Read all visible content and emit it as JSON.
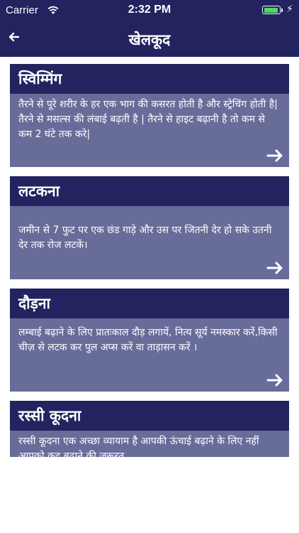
{
  "status_bar": {
    "carrier": "Carrier",
    "time": "2:32 PM",
    "wifi_icon": "wifi-icon",
    "battery_icon": "battery-icon",
    "charging_icon": "bolt-icon",
    "battery_color": "#4cd964"
  },
  "nav": {
    "title": "खेलकूद",
    "back_icon": "back-arrow-icon"
  },
  "theme": {
    "header_color": "#22235f",
    "card_body_color": "#686c99",
    "text_color": "#ffffff"
  },
  "cards": [
    {
      "title": "स्विम्मिंग",
      "body": "तैरने से पूरे शरीर के हर एक भाग की कसरत होती है और स्ट्रेचिंग होती है| तैरने से मसल्स की लंबाई बढ़ती है | तैरने से हाइट बढ़ानी है तो कम से कम 2 घंटे तक करे|",
      "arrow_icon": "right-arrow-icon"
    },
    {
      "title": "लटकना",
      "body": "जमीन से 7 फुट पर एक छंड गाड़े और उस पर जितनी देर हो सके उतनी देर तक रोज लटकें।",
      "arrow_icon": "right-arrow-icon"
    },
    {
      "title": "दौड़ना",
      "body": "लम्बाई बढ़ाने के लिए प्रातःकाल दौड़ लगायें, नित्य सूर्य नमस्कार करें,किसी चीज़ से लटक कर पुल अप्स करें वा ताड़ासन करें ।",
      "arrow_icon": "right-arrow-icon"
    },
    {
      "title": "रस्सी कूदना",
      "body": "रस्सी कूदना एक अच्छा व्यायाम है आपकी ऊंचाई बढ़ाने के लिए नहीं आपको कद बढ़ाने की जरूरत",
      "arrow_icon": "right-arrow-icon"
    }
  ]
}
